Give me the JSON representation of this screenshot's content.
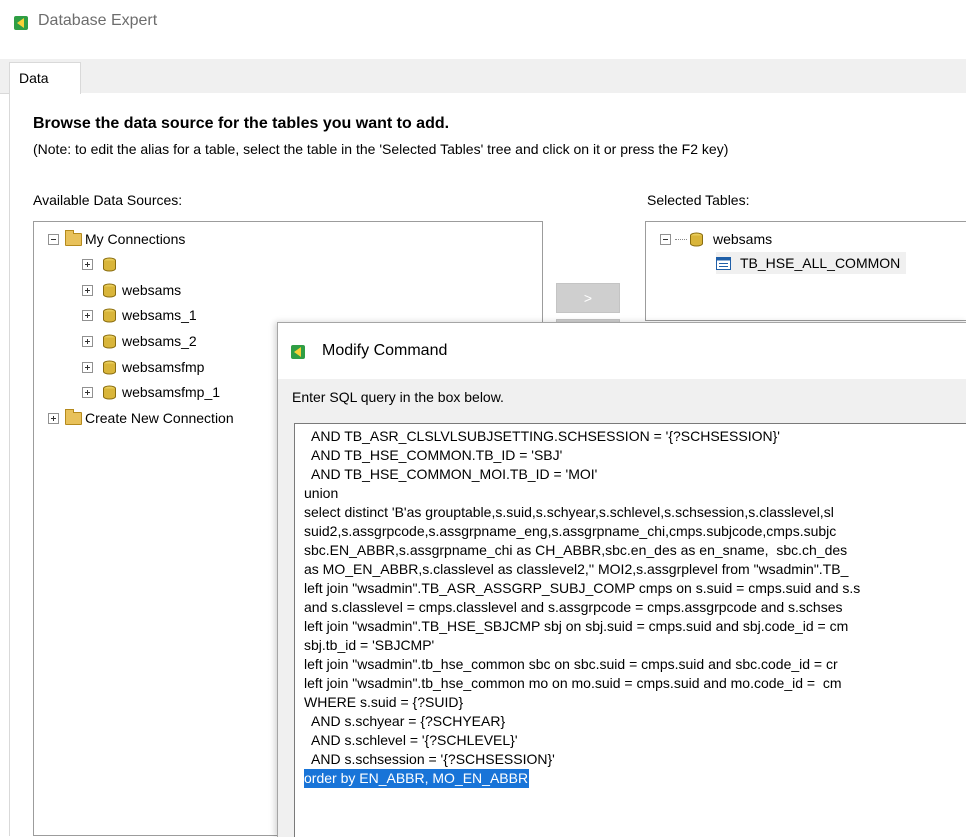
{
  "window": {
    "title": "Database Expert"
  },
  "tabs": [
    {
      "label": "Data"
    }
  ],
  "main": {
    "heading": "Browse the data source for the tables you want to add.",
    "note": "(Note: to edit the alias for a table, select the table in the 'Selected Tables' tree and click on it or press the F2 key)",
    "available_label": "Available Data Sources:",
    "selected_label": "Selected Tables:"
  },
  "available_tree": {
    "root": "My Connections",
    "connections": [
      "",
      "websams",
      "websams_1",
      "websams_2",
      "websamsfmp",
      "websamsfmp_1"
    ],
    "create_new": "Create New Connection"
  },
  "selected_tree": {
    "connection": "websams",
    "table": "TB_HSE_ALL_COMMON"
  },
  "buttons": {
    "add_one": ">"
  },
  "dialog": {
    "title": "Modify Command",
    "prompt": "Enter SQL query in the box below.",
    "sql_lines": [
      "  AND TB_ASR_CLSLVLSUBJSETTING.SCHSESSION = '{?SCHSESSION}'",
      "  AND TB_HSE_COMMON.TB_ID = 'SBJ'",
      "  AND TB_HSE_COMMON_MOI.TB_ID = 'MOI'",
      "union",
      "select distinct 'B'as grouptable,s.suid,s.schyear,s.schlevel,s.schsession,s.classlevel,sl",
      "suid2,s.assgrpcode,s.assgrpname_eng,s.assgrpname_chi,cmps.subjcode,cmps.subjc",
      "sbc.EN_ABBR,s.assgrpname_chi as CH_ABBR,sbc.en_des as en_sname,  sbc.ch_des",
      "as MO_EN_ABBR,s.classlevel as classlevel2,'' MOI2,s.assgrplevel from \"wsadmin\".TB_",
      "left join \"wsadmin\".TB_ASR_ASSGRP_SUBJ_COMP cmps on s.suid = cmps.suid and s.s",
      "and s.classlevel = cmps.classlevel and s.assgrpcode = cmps.assgrpcode and s.schses",
      "left join \"wsadmin\".TB_HSE_SBJCMP sbj on sbj.suid = cmps.suid and sbj.code_id = cm",
      "sbj.tb_id = 'SBJCMP'",
      "left join \"wsadmin\".tb_hse_common sbc on sbc.suid = cmps.suid and sbc.code_id = cr",
      "left join \"wsadmin\".tb_hse_common mo on mo.suid = cmps.suid and mo.code_id =  cm",
      "WHERE s.suid = {?SUID}",
      "  AND s.schyear = {?SCHYEAR}",
      "  AND s.schlevel = '{?SCHLEVEL}'",
      "  AND s.schsession = '{?SCHSESSION}'",
      "order by EN_ABBR, MO_EN_ABBR"
    ]
  },
  "colors": {
    "selection": "#1874d8",
    "folder": "#e8c15a",
    "database": "#d9b53a"
  }
}
